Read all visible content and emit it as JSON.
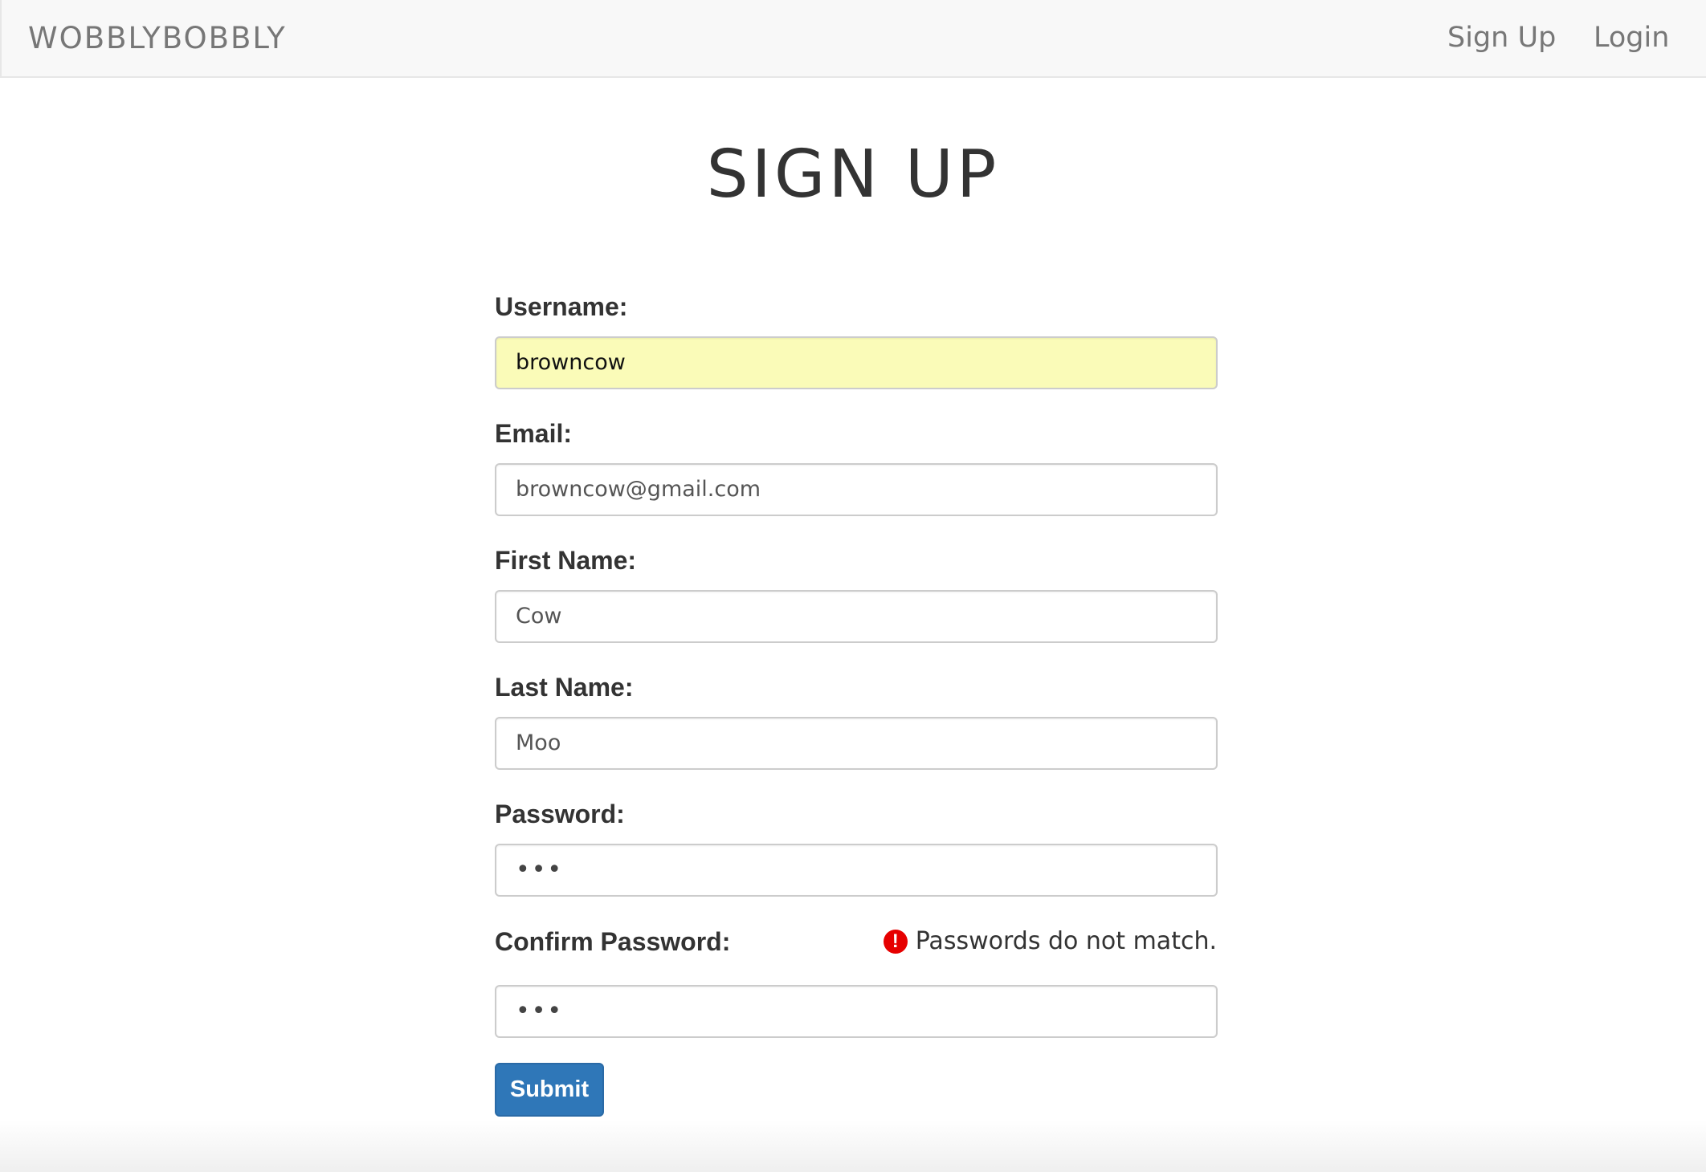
{
  "navbar": {
    "brand": "WOBBLYBOBBLY",
    "links": [
      {
        "label": "Sign Up"
      },
      {
        "label": "Login"
      }
    ]
  },
  "page": {
    "title": "SIGN UP"
  },
  "form": {
    "fields": [
      {
        "label": "Username:",
        "value": "browncow"
      },
      {
        "label": "Email:",
        "value": "browncow@gmail.com"
      },
      {
        "label": "First Name:",
        "value": "Cow"
      },
      {
        "label": "Last Name:",
        "value": "Moo"
      },
      {
        "label": "Password:",
        "value": "•••"
      },
      {
        "label": "Confirm Password:",
        "value": "•••"
      }
    ],
    "error": {
      "icon": "exclamation-circle-icon",
      "icon_glyph": "!",
      "message": "Passwords do not match.",
      "color": "#e60000"
    },
    "submit_label": "Submit"
  },
  "colors": {
    "navbar_bg": "#f8f8f8",
    "autofill_bg": "#fafbb8",
    "primary_button": "#2f77b8"
  }
}
